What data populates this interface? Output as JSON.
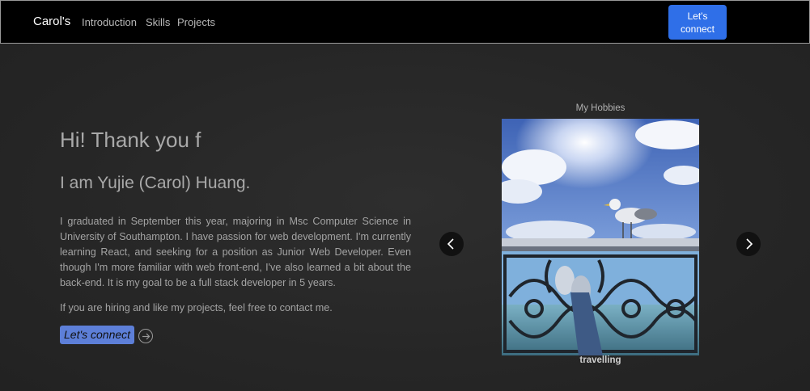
{
  "navbar": {
    "brand": "Carol's",
    "links": [
      "Introduction",
      "Skills",
      "Projects"
    ],
    "connect_button": "Let's connect",
    "background": "#000000",
    "button_color": "#2f6fe8"
  },
  "hero": {
    "title": "Hi! Thank you f",
    "subtitle": "I am Yujie (Carol) Huang.",
    "paragraph1": "I graduated in September this year, majoring in Msc Computer Science in University of Southampton. I have passion for web development. I'm currently learning React, and seeking for a position as Junior Web Developer. Even though I'm more familiar with web front-end, I've also learned a bit about the back-end. It is my goal to be a full stack developer in 5 years.",
    "paragraph2": "If you are hiring and like my projects, feel free to contact me.",
    "cta_label": "Let's connect",
    "cta_color": "#5d7fd8",
    "cta_arrow_icon": "arrow-right-circle-icon"
  },
  "carousel": {
    "heading": "My Hobbies",
    "caption": "travelling",
    "prev_icon": "chevron-left-icon",
    "next_icon": "chevron-right-icon"
  }
}
